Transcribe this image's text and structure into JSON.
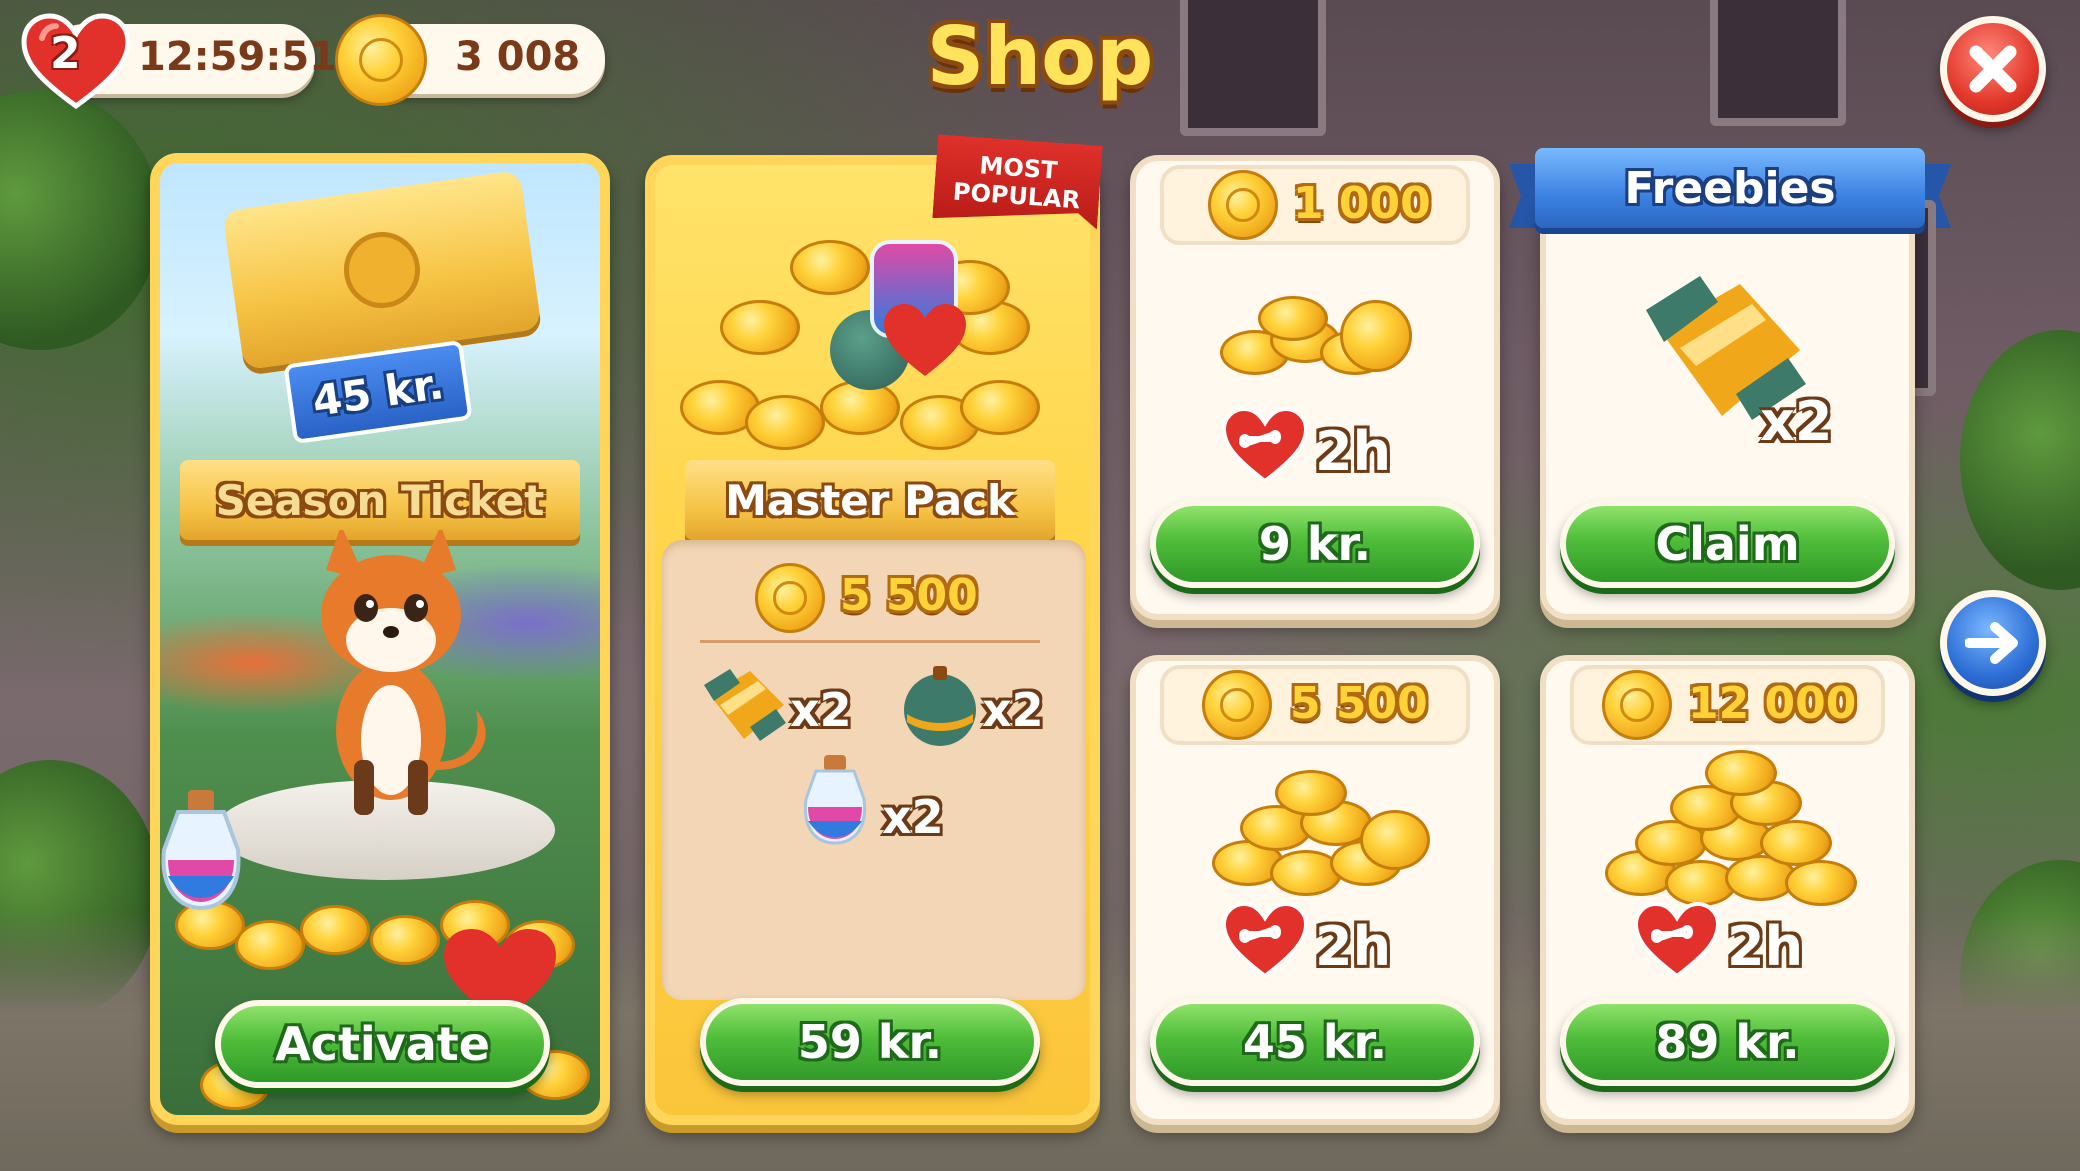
{
  "hud": {
    "lives": "2",
    "timer": "12:59:51",
    "coins": "3 008"
  },
  "title": "Shop",
  "season_ticket": {
    "price_tag": "45 kr.",
    "label": "Season Ticket",
    "button": "Activate"
  },
  "master_pack": {
    "badge_line1": "MOST",
    "badge_line2": "POPULAR",
    "label": "Master Pack",
    "coins": "5 500",
    "items": [
      {
        "icon": "rocket-icon",
        "qty": "x2"
      },
      {
        "icon": "bomb-icon",
        "qty": "x2"
      },
      {
        "icon": "potion-icon",
        "qty": "x2"
      }
    ],
    "button": "59 kr."
  },
  "offers": [
    {
      "coins": "1 000",
      "duration": "2h",
      "button": "9 kr."
    },
    {
      "coins": "5 500",
      "duration": "2h",
      "button": "45 kr."
    },
    {
      "coins": "12 000",
      "duration": "2h",
      "button": "89 kr."
    }
  ],
  "freebies": {
    "banner": "Freebies",
    "qty": "x2",
    "button": "Claim"
  },
  "colors": {
    "gold": "#ffd23a",
    "green_button": "#4fbd3a",
    "close_red": "#e2382b",
    "arrow_blue": "#2d6fd6"
  }
}
